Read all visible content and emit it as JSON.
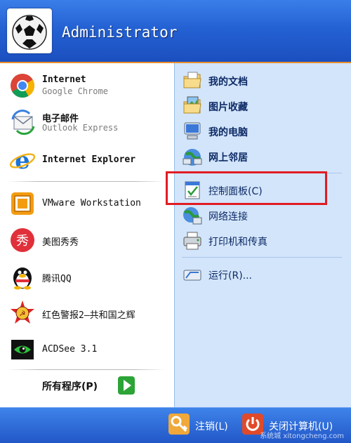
{
  "header": {
    "username": "Administrator"
  },
  "pinned": [
    {
      "title": "Internet",
      "subtitle": "Google Chrome",
      "icon": "chrome-icon"
    },
    {
      "title": "电子邮件",
      "subtitle": "Outlook Express",
      "icon": "outlook-express-icon"
    }
  ],
  "internet_explorer": {
    "title": "Internet Explorer",
    "icon": "internet-explorer-icon"
  },
  "recent": [
    {
      "label": "VMware Workstation",
      "icon": "vmware-icon"
    },
    {
      "label": "美图秀秀",
      "icon": "meitu-icon"
    },
    {
      "label": "腾讯QQ",
      "icon": "qq-penguin-icon"
    },
    {
      "label": "红色警报2—共和国之辉",
      "icon": "red-alert-icon"
    },
    {
      "label": "ACDSee 3.1",
      "icon": "acdsee-icon"
    }
  ],
  "all_programs": {
    "label": "所有程序(P)"
  },
  "places": [
    {
      "label": "我的文档",
      "icon": "my-documents-icon"
    },
    {
      "label": "图片收藏",
      "icon": "my-pictures-icon"
    },
    {
      "label": "我的电脑",
      "icon": "my-computer-icon"
    },
    {
      "label": "网上邻居",
      "icon": "network-places-icon"
    },
    {
      "label": "控制面板(C)",
      "icon": "control-panel-icon"
    },
    {
      "label": "网络连接",
      "icon": "network-connections-icon"
    },
    {
      "label": "打印机和传真",
      "icon": "printers-icon"
    },
    {
      "label": "运行(R)...",
      "icon": "run-icon"
    }
  ],
  "footer": {
    "logoff": "注销(L)",
    "shutdown": "关闭计算机(U)",
    "watermark": "系统城 xitongcheng.com"
  }
}
